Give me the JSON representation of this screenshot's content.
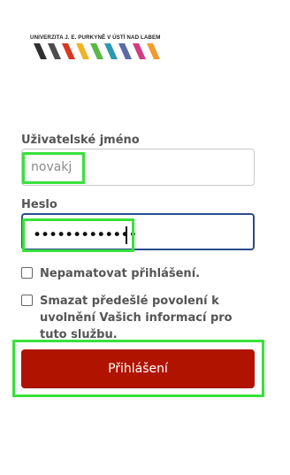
{
  "logo": {
    "text": "UNIVERZITA J. E. PURKYNĚ V ÚSTÍ NAD LABEM",
    "stripe_colors": [
      "#2f2f2f",
      "#4c4c4c",
      "#d9371f",
      "#f0b323",
      "#58b947",
      "#2a9ab1",
      "#5b69a9",
      "#d23c84",
      "#f39a2d"
    ]
  },
  "username": {
    "label": "Uživatelské jméno",
    "value": "novakj"
  },
  "password": {
    "label": "Heslo",
    "masked_value": "•••••••••••••"
  },
  "remember": {
    "label": "Nepamatovat přihlášení."
  },
  "clear_consent": {
    "label": "Smazat předešlé povolení k uvolnění Vašich informací pro tuto službu."
  },
  "login_button": {
    "label": "Přihlášení"
  },
  "highlight": {
    "color": "#39e13c"
  },
  "accent_colors": {
    "button": "#b01400",
    "focus_border": "#2a4b8d"
  }
}
